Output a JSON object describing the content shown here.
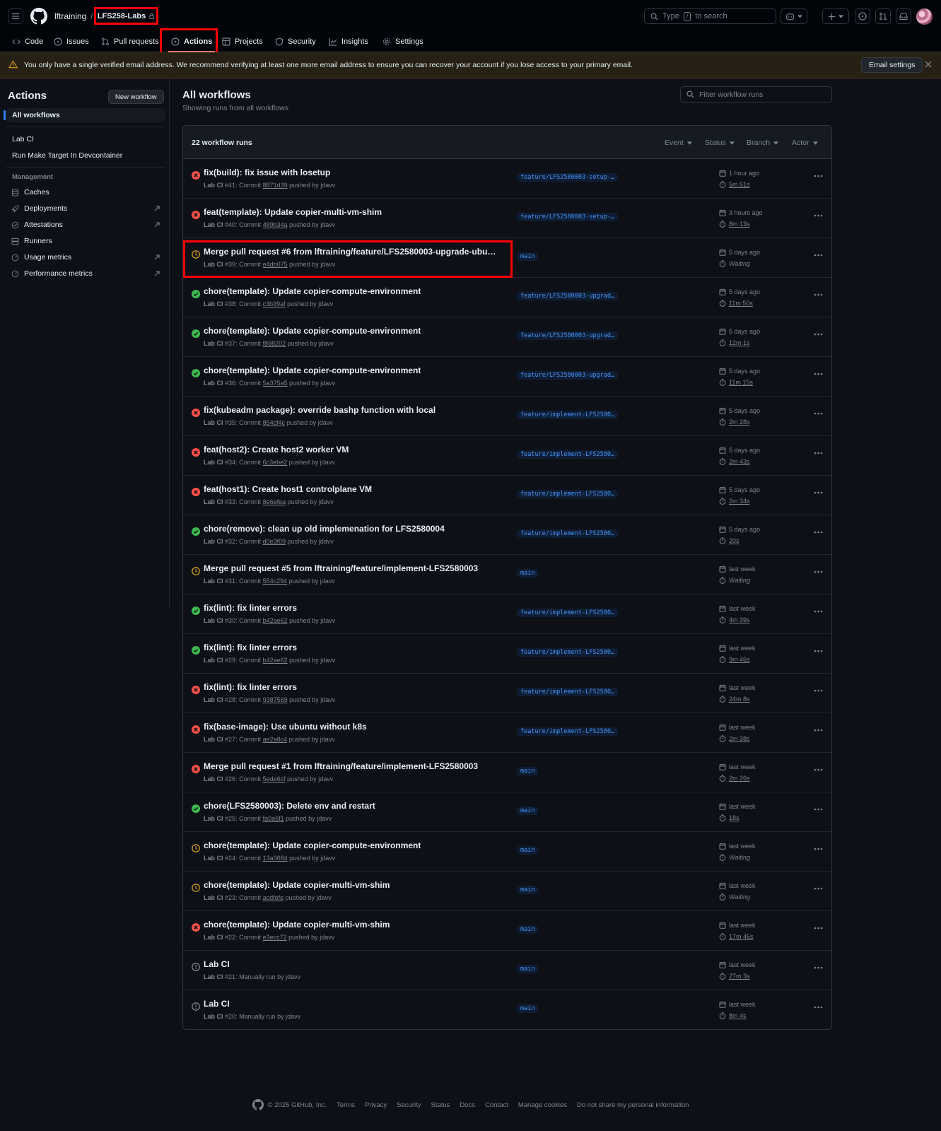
{
  "header": {
    "owner": "lftraining",
    "separator": "/",
    "repo": "LFS258-Labs",
    "search": {
      "pre": "Type",
      "key": "/",
      "post": "to search"
    }
  },
  "tabs": [
    {
      "label": "Code",
      "icon": "code-icon"
    },
    {
      "label": "Issues",
      "icon": "issue-opened-icon"
    },
    {
      "label": "Pull requests",
      "icon": "git-pull-request-icon"
    },
    {
      "label": "Actions",
      "icon": "play-icon",
      "active": true
    },
    {
      "label": "Projects",
      "icon": "table-icon"
    },
    {
      "label": "Security",
      "icon": "shield-icon"
    },
    {
      "label": "Insights",
      "icon": "graph-icon"
    },
    {
      "label": "Settings",
      "icon": "gear-icon"
    }
  ],
  "banner": {
    "message": "You only have a single verified email address. We recommend verifying at least one more email address to ensure you can recover your account if you lose access to your primary email.",
    "button": "Email settings"
  },
  "sidebar": {
    "title": "Actions",
    "new_workflow": "New workflow",
    "all_workflows": "All workflows",
    "workflows": [
      "Lab CI",
      "Run Make Target In Devcontainer"
    ],
    "management_heading": "Management",
    "management": [
      {
        "label": "Caches",
        "icon": "database-icon",
        "external": false
      },
      {
        "label": "Deployments",
        "icon": "rocket-icon",
        "external": true
      },
      {
        "label": "Attestations",
        "icon": "verified-icon",
        "external": true
      },
      {
        "label": "Runners",
        "icon": "server-icon",
        "external": false
      },
      {
        "label": "Usage metrics",
        "icon": "meter-icon",
        "external": true
      },
      {
        "label": "Performance metrics",
        "icon": "meter-icon",
        "external": true
      }
    ]
  },
  "main": {
    "title": "All workflows",
    "subtitle": "Showing runs from all workflows",
    "filter_placeholder": "Filter workflow runs",
    "runs_count": "22 workflow runs",
    "filters": [
      "Event",
      "Status",
      "Branch",
      "Actor"
    ]
  },
  "colors": {
    "success": "#3fb950",
    "failure": "#f85149",
    "waiting": "#d29922",
    "neutral": "#7d8590",
    "highlight": "#ff0000"
  },
  "runs": [
    {
      "status": "failure",
      "title": "fix(build): fix issue with losetup",
      "workflow": "Lab CI",
      "num": "#41",
      "trigger": "Commit",
      "sha": "8871d39",
      "actor": "jdavv",
      "branch": "feature/LFS2580003-setup-…",
      "when": "1 hour ago",
      "duration": "5m 51s"
    },
    {
      "status": "failure",
      "title": "feat(template): Update copier-multi-vm-shim",
      "workflow": "Lab CI",
      "num": "#40",
      "trigger": "Commit",
      "sha": "489b34a",
      "actor": "jdavv",
      "branch": "feature/LFS2580003-setup-…",
      "when": "3 hours ago",
      "duration": "8m 13s"
    },
    {
      "status": "waiting",
      "title": "Merge pull request #6 from lftraining/feature/LFS2580003-upgrade-ubu…",
      "workflow": "Lab CI",
      "num": "#39",
      "trigger": "Commit",
      "sha": "e4db075",
      "actor": "jdavv",
      "branch": "main",
      "when": "5 days ago",
      "duration": "Waiting"
    },
    {
      "status": "success",
      "title": "chore(template): Update copier-compute-environment",
      "workflow": "Lab CI",
      "num": "#38",
      "trigger": "Commit",
      "sha": "c3b39af",
      "actor": "jdavv",
      "branch": "feature/LFS2580003-upgrad…",
      "when": "5 days ago",
      "duration": "11m 50s"
    },
    {
      "status": "success",
      "title": "chore(template): Update copier-compute-environment",
      "workflow": "Lab CI",
      "num": "#37",
      "trigger": "Commit",
      "sha": "f898202",
      "actor": "jdavv",
      "branch": "feature/LFS2580003-upgrad…",
      "when": "5 days ago",
      "duration": "12m 1s"
    },
    {
      "status": "success",
      "title": "chore(template): Update copier-compute-environment",
      "workflow": "Lab CI",
      "num": "#36",
      "trigger": "Commit",
      "sha": "5a375a5",
      "actor": "jdavv",
      "branch": "feature/LFS2580003-upgrad…",
      "when": "5 days ago",
      "duration": "11m 15s"
    },
    {
      "status": "failure",
      "title": "fix(kubeadm package): override bashp function with local",
      "workflow": "Lab CI",
      "num": "#35",
      "trigger": "Commit",
      "sha": "854cf4c",
      "actor": "jdavv",
      "branch": "feature/implement-LFS2580…",
      "when": "5 days ago",
      "duration": "2m 28s"
    },
    {
      "status": "failure",
      "title": "feat(host2): Create host2 worker VM",
      "workflow": "Lab CI",
      "num": "#34",
      "trigger": "Commit",
      "sha": "6c3ebe2",
      "actor": "jdavv",
      "branch": "feature/implement-LFS2580…",
      "when": "5 days ago",
      "duration": "2m 43s"
    },
    {
      "status": "failure",
      "title": "feat(host1): Create host1 controlplane VM",
      "workflow": "Lab CI",
      "num": "#33",
      "trigger": "Commit",
      "sha": "8e6efea",
      "actor": "jdavv",
      "branch": "feature/implement-LFS2580…",
      "when": "5 days ago",
      "duration": "2m 34s"
    },
    {
      "status": "success",
      "title": "chore(remove): clean up old implemenation for LFS2580004",
      "workflow": "Lab CI",
      "num": "#32",
      "trigger": "Commit",
      "sha": "d0e3f09",
      "actor": "jdavv",
      "branch": "feature/implement-LFS2580…",
      "when": "5 days ago",
      "duration": "20s"
    },
    {
      "status": "waiting",
      "title": "Merge pull request #5 from lftraining/feature/implement-LFS2580003",
      "workflow": "Lab CI",
      "num": "#31",
      "trigger": "Commit",
      "sha": "554c294",
      "actor": "jdavv",
      "branch": "main",
      "when": "last week",
      "duration": "Waiting"
    },
    {
      "status": "success",
      "title": "fix(lint): fix linter errors",
      "workflow": "Lab CI",
      "num": "#30",
      "trigger": "Commit",
      "sha": "b42ae62",
      "actor": "jdavv",
      "branch": "feature/implement-LFS2580…",
      "when": "last week",
      "duration": "4m 39s"
    },
    {
      "status": "success",
      "title": "fix(lint): fix linter errors",
      "workflow": "Lab CI",
      "num": "#29",
      "trigger": "Commit",
      "sha": "b42ae62",
      "actor": "jdavv",
      "branch": "feature/implement-LFS2580…",
      "when": "last week",
      "duration": "9m 46s"
    },
    {
      "status": "failure",
      "title": "fix(lint): fix linter errors",
      "workflow": "Lab CI",
      "num": "#28",
      "trigger": "Commit",
      "sha": "9387569",
      "actor": "jdavv",
      "branch": "feature/implement-LFS2580…",
      "when": "last week",
      "duration": "24m 8s"
    },
    {
      "status": "failure",
      "title": "fix(base-image): Use ubuntu without k8s",
      "workflow": "Lab CI",
      "num": "#27",
      "trigger": "Commit",
      "sha": "ae2a8c4",
      "actor": "jdavv",
      "branch": "feature/implement-LFS2580…",
      "when": "last week",
      "duration": "2m 38s"
    },
    {
      "status": "failure",
      "title": "Merge pull request #1 from lftraining/feature/implement-LFS2580003",
      "workflow": "Lab CI",
      "num": "#26",
      "trigger": "Commit",
      "sha": "5ede6cf",
      "actor": "jdavv",
      "branch": "main",
      "when": "last week",
      "duration": "2m 26s"
    },
    {
      "status": "success",
      "title": "chore(LFS2580003): Delete env and restart",
      "workflow": "Lab CI",
      "num": "#25",
      "trigger": "Commit",
      "sha": "fa0a6f1",
      "actor": "jdavv",
      "branch": "main",
      "when": "last week",
      "duration": "18s"
    },
    {
      "status": "waiting",
      "title": "chore(template): Update copier-compute-environment",
      "workflow": "Lab CI",
      "num": "#24",
      "trigger": "Commit",
      "sha": "13a3684",
      "actor": "jdavv",
      "branch": "main",
      "when": "last week",
      "duration": "Waiting"
    },
    {
      "status": "waiting",
      "title": "chore(template): Update copier-multi-vm-shim",
      "workflow": "Lab CI",
      "num": "#23",
      "trigger": "Commit",
      "sha": "acdfefe",
      "actor": "jdavv",
      "branch": "main",
      "when": "last week",
      "duration": "Waiting"
    },
    {
      "status": "failure",
      "title": "chore(template): Update copier-multi-vm-shim",
      "workflow": "Lab CI",
      "num": "#22",
      "trigger": "Commit",
      "sha": "e3ecc72",
      "actor": "jdavv",
      "branch": "main",
      "when": "last week",
      "duration": "17m 45s"
    },
    {
      "status": "neutral",
      "title": "Lab CI",
      "workflow": "Lab CI",
      "num": "#21",
      "trigger": "Manually run",
      "sha": "",
      "actor": "jdavv",
      "branch": "main",
      "when": "last week",
      "duration": "27m 3s"
    },
    {
      "status": "neutral",
      "title": "Lab CI",
      "workflow": "Lab CI",
      "num": "#20",
      "trigger": "Manually run",
      "sha": "",
      "actor": "jdavv",
      "branch": "main",
      "when": "last week",
      "duration": "8m 4s"
    }
  ],
  "footer": {
    "copyright": "© 2025 GitHub, Inc.",
    "links": [
      "Terms",
      "Privacy",
      "Security",
      "Status",
      "Docs",
      "Contact",
      "Manage cookies",
      "Do not share my personal information"
    ]
  }
}
